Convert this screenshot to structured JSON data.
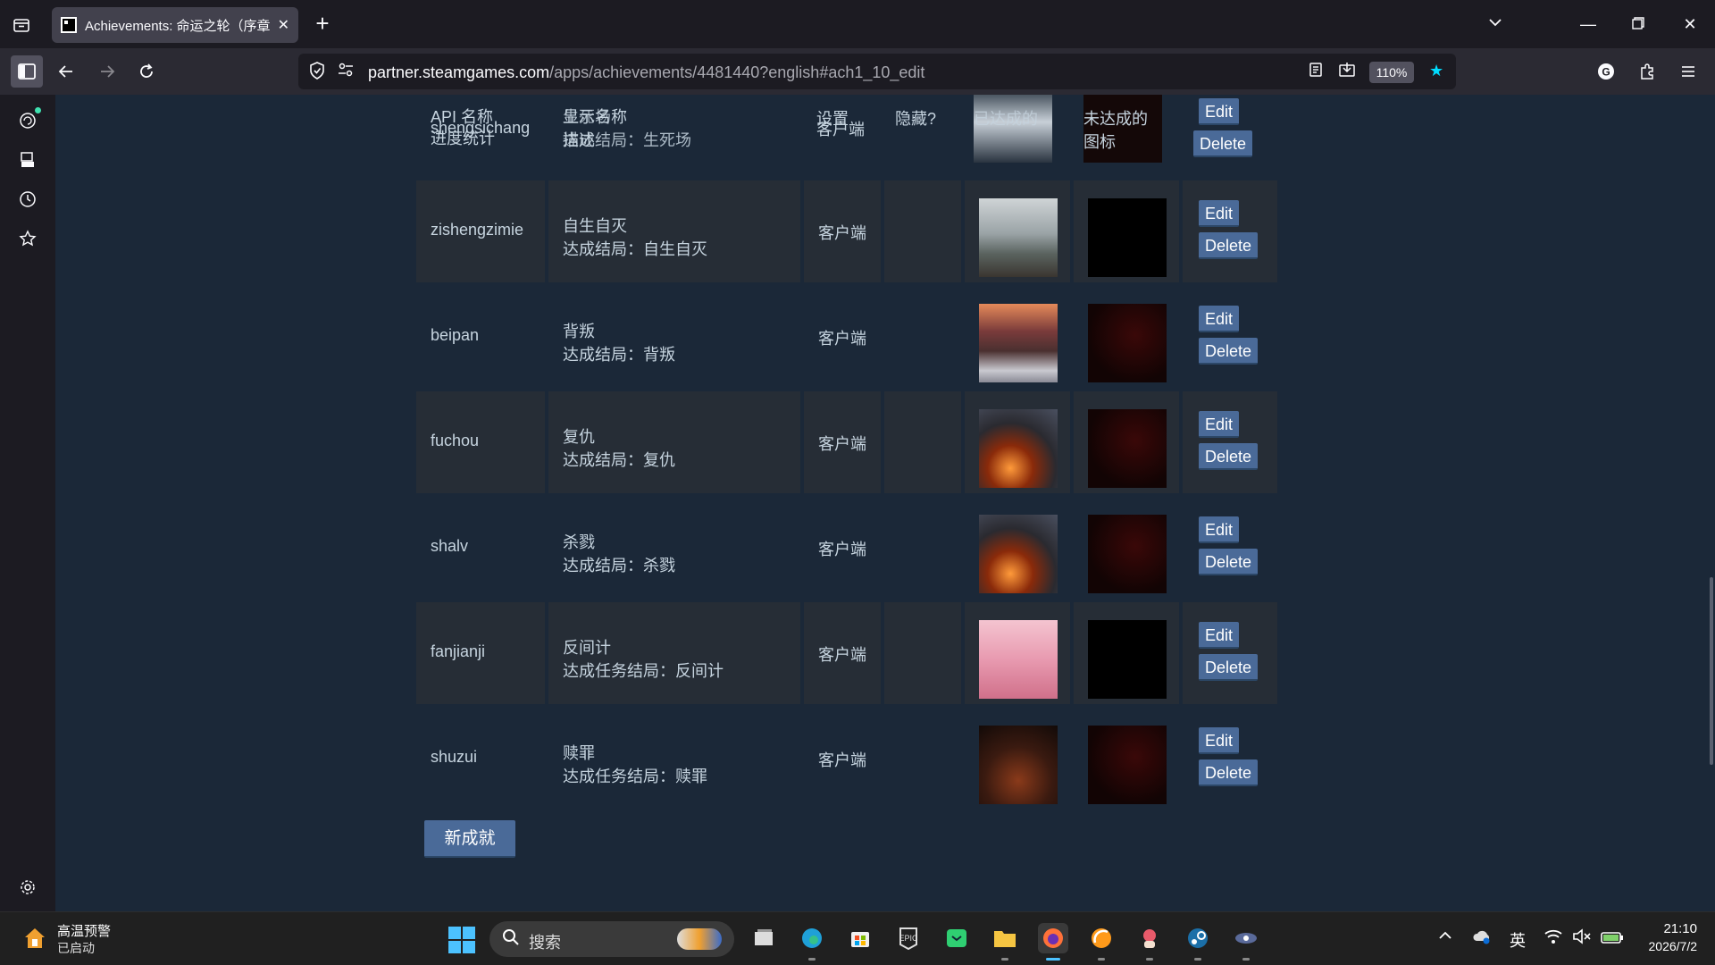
{
  "browser": {
    "tab_title": "Achievements: 命运之轮（序章",
    "url_host": "partner.steamgames.com",
    "url_path": "/apps/achievements/4481440?english#ach1_10_edit",
    "zoom": "110%"
  },
  "table": {
    "header": {
      "api_name": "API 名称",
      "progress": "进度统计",
      "display_name": "显示名称",
      "description": "描述",
      "settings": "设置",
      "hidden": "隐藏?",
      "achieved_icon": "已达成的",
      "unachieved_icon_1": "未达成的",
      "unachieved_icon_2": "图标",
      "overlap_api": "shengsichang",
      "overlap_name": "生死场",
      "overlap_desc": "达成结局：生死场",
      "overlap_client": "客户端",
      "edit": "Edit",
      "delete": "Delete"
    },
    "rows": [
      {
        "api": "zishengzimie",
        "name": "自生自灭",
        "desc": "达成结局：自生自灭",
        "client": "客户端",
        "edit": "Edit",
        "delete": "Delete"
      },
      {
        "api": "beipan",
        "name": "背叛",
        "desc": "达成结局：背叛",
        "client": "客户端",
        "edit": "Edit",
        "delete": "Delete"
      },
      {
        "api": "fuchou",
        "name": "复仇",
        "desc": "达成结局：复仇",
        "client": "客户端",
        "edit": "Edit",
        "delete": "Delete"
      },
      {
        "api": "shalv",
        "name": "杀戮",
        "desc": "达成结局：杀戮",
        "client": "客户端",
        "edit": "Edit",
        "delete": "Delete"
      },
      {
        "api": "fanjianji",
        "name": "反间计",
        "desc": "达成任务结局：反间计",
        "client": "客户端",
        "edit": "Edit",
        "delete": "Delete"
      },
      {
        "api": "shuzui",
        "name": "赎罪",
        "desc": "达成任务结局：赎罪",
        "client": "客户端",
        "edit": "Edit",
        "delete": "Delete"
      }
    ]
  },
  "new_achievement_button": "新成就",
  "taskbar": {
    "weather_title": "高温预警",
    "weather_sub": "已启动",
    "search_placeholder": "搜索",
    "ime": "英",
    "time": "21:10",
    "date": "2026/7/2"
  }
}
